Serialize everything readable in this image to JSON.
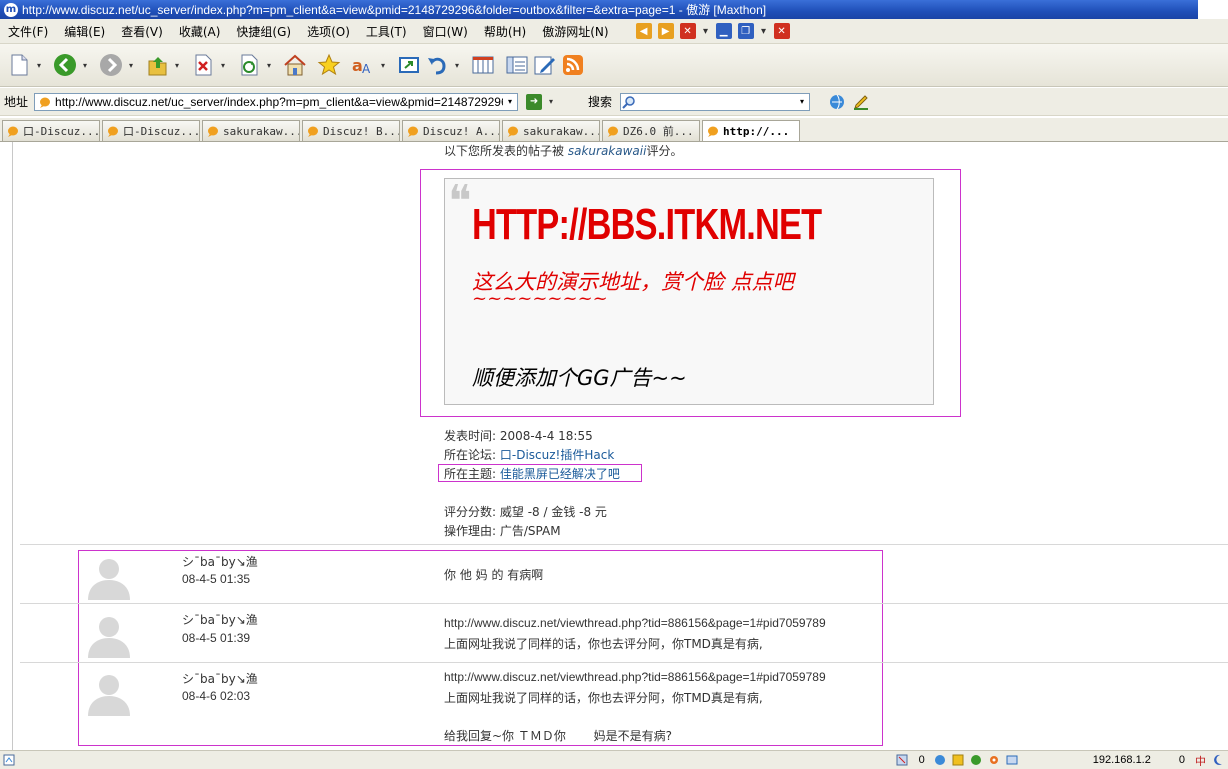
{
  "window": {
    "title": "http://www.discuz.net/uc_server/index.php?m=pm_client&a=view&pmid=2148729296&folder=outbox&filter=&extra=page=1 - 傲游 [Maxthon]"
  },
  "menu": {
    "items": [
      "文件(F)",
      "编辑(E)",
      "查看(V)",
      "收藏(A)",
      "快捷组(G)",
      "选项(O)",
      "工具(T)",
      "窗口(W)",
      "帮助(H)",
      "傲游网址(N)"
    ]
  },
  "toolbar": {
    "icons": [
      "new-page-icon",
      "back-icon",
      "forward-icon",
      "up-icon",
      "stop-icon",
      "refresh-icon",
      "home-icon",
      "favorites-star-icon",
      "translate-icon",
      "fullscreen-icon",
      "undo-icon",
      "columns-icon",
      "sidebar-icon",
      "edit-icon",
      "rss-icon"
    ]
  },
  "address": {
    "label": "地址",
    "url": "http://www.discuz.net/uc_server/index.php?m=pm_client&a=view&pmid=2148729296&folder",
    "search_label": "搜索",
    "search_value": ""
  },
  "tabs": [
    {
      "label": "口-Discuz..."
    },
    {
      "label": "口-Discuz..."
    },
    {
      "label": "sakurakaw..."
    },
    {
      "label": "Discuz! B..."
    },
    {
      "label": "Discuz! A..."
    },
    {
      "label": "sakurakaw..."
    },
    {
      "label": "DZ6.0 前..."
    },
    {
      "label": "http://..."
    }
  ],
  "post": {
    "rate_intro_prefix": "以下您所发表的帖子被",
    "rate_user": "sakurakawaii",
    "rate_intro_suffix": "评分。",
    "big_url": "HTTP://BBS.ITKM.NET",
    "red_line": "这么大的演示地址，赏个脸 点点吧",
    "red_tilde": "~~~~~~~~~",
    "ad_line": "顺便添加个GG广告~~",
    "posted_label": "发表时间:",
    "posted_time": "2008-4-4 18:55",
    "forum_label": "所在论坛:",
    "forum_name": "口-Discuz!插件Hack",
    "topic_label": "所在主题:",
    "topic_name": "佳能黑屏已经解决了吧",
    "score_label": "评分分数:",
    "score_value": "威望 -8 / 金钱 -8 元",
    "reason_label": "操作理由:",
    "reason_value": "广告/SPAM"
  },
  "replies": [
    {
      "user": "シ¯ba¯by↘渔",
      "date": "08-4-5 01:35",
      "lines": [
        "你 他 妈 的 有病啊"
      ]
    },
    {
      "user": "シ¯ba¯by↘渔",
      "date": "08-4-5 01:39",
      "lines": [
        "http://www.discuz.net/viewthread.php?tid=886156&page=1#pid7059789",
        "上面网址我说了同样的话，你也去评分阿，你TMD真是有病,"
      ]
    },
    {
      "user": "シ¯ba¯by↘渔",
      "date": "08-4-6 02:03",
      "lines": [
        "http://www.discuz.net/viewthread.php?tid=886156&page=1#pid7059789",
        "上面网址我说了同样的话，你也去评分阿，你TMD真是有病,",
        "给我回复~你 ＴＭＤ你 　　妈是不是有病?"
      ]
    }
  ],
  "status": {
    "count": "0",
    "ip": "192.168.1.2",
    "right_count": "0"
  }
}
